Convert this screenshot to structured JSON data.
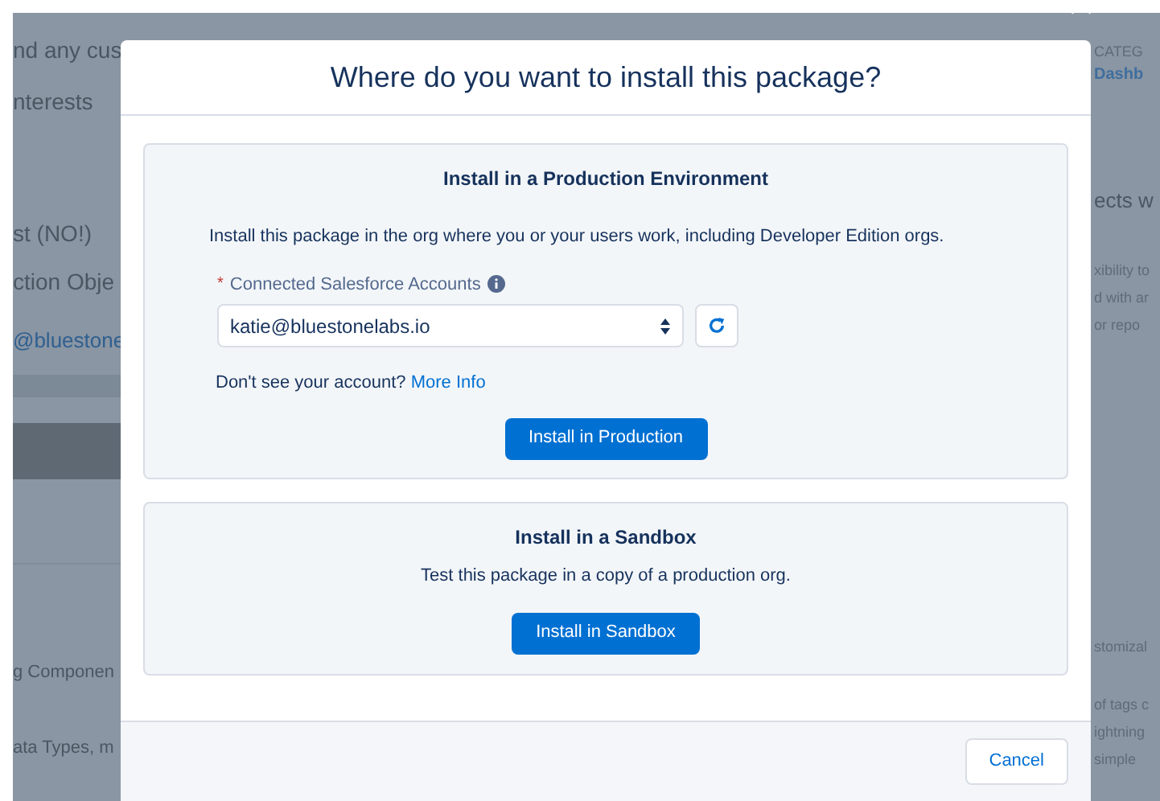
{
  "background_page": {
    "left_texts": [
      {
        "text": "nd any cus",
        "kind": "text"
      },
      {
        "text": "nterests",
        "kind": "text"
      },
      {
        "text": "st (NO!)",
        "kind": "text"
      },
      {
        "text": "ction Obje",
        "kind": "text"
      },
      {
        "text": "@bluestone",
        "kind": "link"
      },
      {
        "text": "g Componen",
        "kind": "small"
      },
      {
        "text": "ata Types, m",
        "kind": "small"
      }
    ],
    "right_texts": [
      {
        "text": "CATEG",
        "kind": "caption"
      },
      {
        "text": "Dashb",
        "kind": "link"
      },
      {
        "text": "ects w",
        "kind": "heading"
      },
      {
        "text": "xibility to",
        "kind": "text"
      },
      {
        "text": "d with ar",
        "kind": "text"
      },
      {
        "text": "or repo",
        "kind": "text"
      },
      {
        "text": "stomizal",
        "kind": "text"
      },
      {
        "text": "of tags c",
        "kind": "text"
      },
      {
        "text": "ightning",
        "kind": "text"
      },
      {
        "text": "simple",
        "kind": "text"
      }
    ]
  },
  "modal": {
    "title": "Where do you want to install this package?",
    "production": {
      "heading": "Install in a Production Environment",
      "description": "Install this package in the org where you or your users work, including Developer Edition orgs.",
      "field_label": "Connected Salesforce Accounts",
      "required_mark": "*",
      "account_value": "katie@bluestonelabs.io",
      "help_text": "Don't see your account?",
      "help_link": "More Info",
      "button": "Install in Production"
    },
    "sandbox": {
      "heading": "Install in a Sandbox",
      "description": "Test this package in a copy of a production org.",
      "button": "Install in Sandbox"
    },
    "footer_buttons": [
      "Cancel"
    ]
  }
}
